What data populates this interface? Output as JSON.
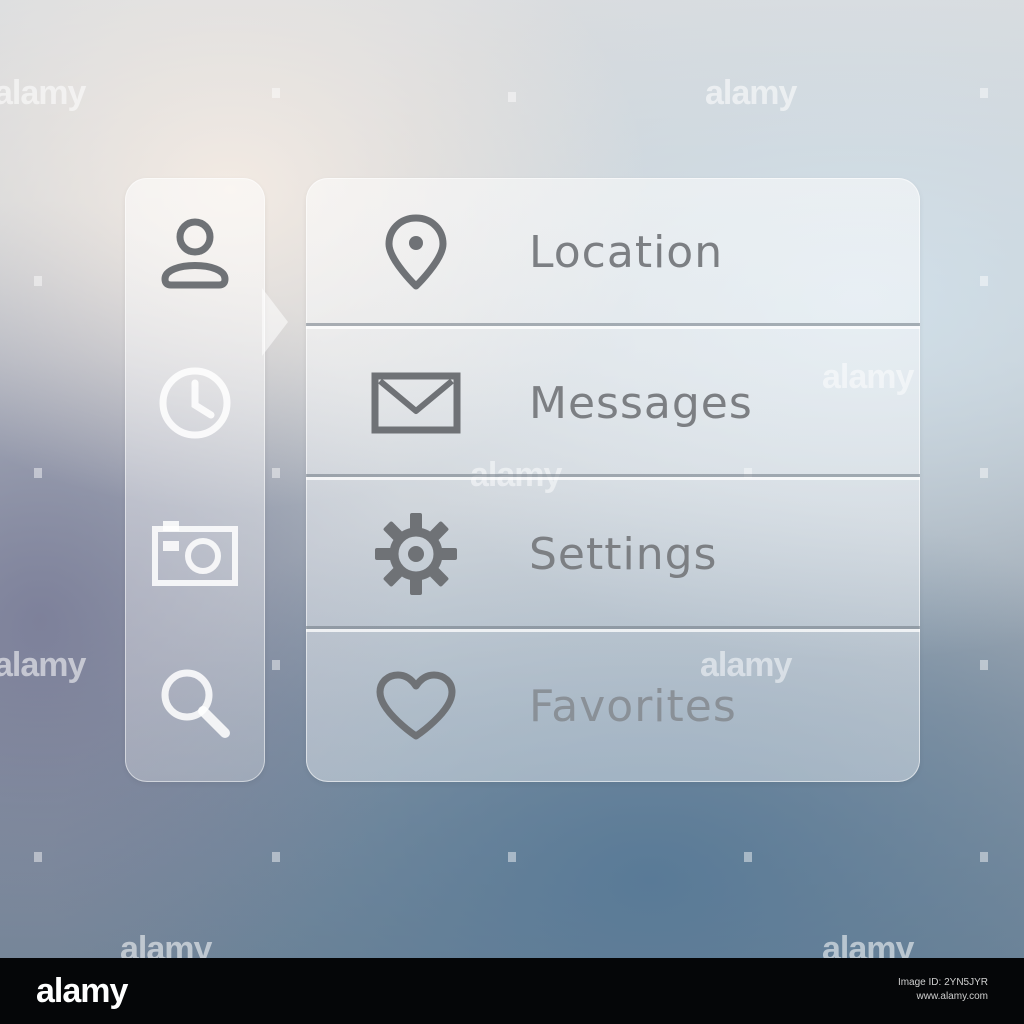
{
  "watermark": {
    "text": "alamy"
  },
  "rail": {
    "items": [
      {
        "icon": "user-icon",
        "active": true
      },
      {
        "icon": "clock-icon",
        "active": false
      },
      {
        "icon": "camera-icon",
        "active": false
      },
      {
        "icon": "search-icon",
        "active": false
      }
    ]
  },
  "menu": {
    "items": [
      {
        "label": "Location",
        "icon": "location-pin-icon"
      },
      {
        "label": "Messages",
        "icon": "envelope-icon"
      },
      {
        "label": "Settings",
        "icon": "gear-icon"
      },
      {
        "label": "Favorites",
        "icon": "heart-icon"
      }
    ]
  },
  "footer": {
    "logo": "alamy",
    "image_id_line": "Image ID: 2YN5JYR",
    "site_line": "www.alamy.com"
  },
  "colors": {
    "icon_dark": "#6f7276",
    "icon_light": "#ffffff",
    "label": "#7c7f83",
    "footer_bg": "#050608"
  }
}
